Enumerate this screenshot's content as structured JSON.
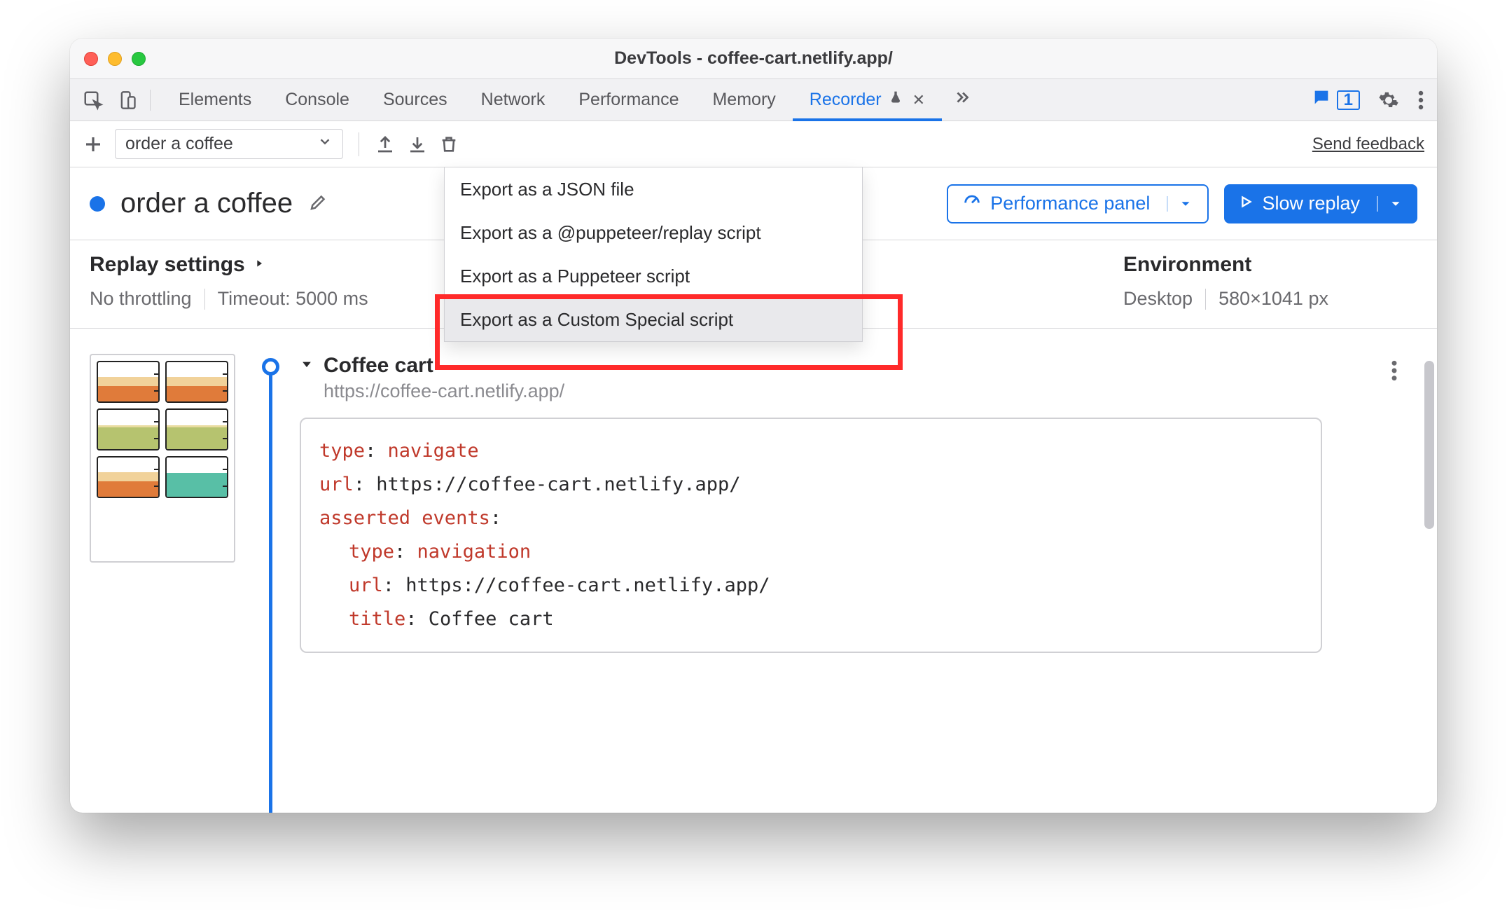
{
  "window": {
    "title": "DevTools - coffee-cart.netlify.app/"
  },
  "tabs": {
    "items": [
      "Elements",
      "Console",
      "Sources",
      "Network",
      "Performance",
      "Memory",
      "Recorder"
    ],
    "active": "Recorder",
    "issues_count": "1"
  },
  "subbar": {
    "recording_select": "order a coffee",
    "send_feedback": "Send feedback"
  },
  "header": {
    "name": "order a coffee",
    "perf_panel": "Performance panel",
    "slow_replay": "Slow replay"
  },
  "export_menu": {
    "items": [
      "Export as a JSON file",
      "Export as a @puppeteer/replay script",
      "Export as a Puppeteer script",
      "Export as a Custom Special script"
    ],
    "hovered_index": 3
  },
  "replay": {
    "heading": "Replay settings",
    "throttling": "No throttling",
    "timeout": "Timeout: 5000 ms"
  },
  "env": {
    "heading": "Environment",
    "device": "Desktop",
    "viewport": "580×1041 px"
  },
  "step": {
    "title": "Coffee cart",
    "url": "https://coffee-cart.netlify.app/",
    "code": {
      "l1k": "type",
      "l1v": "navigate",
      "l2k": "url",
      "l2v": "https://coffee-cart.netlify.app/",
      "l3k": "asserted events",
      "l4k": "type",
      "l4v": "navigation",
      "l5k": "url",
      "l5v": "https://coffee-cart.netlify.app/",
      "l6k": "title",
      "l6v": "Coffee cart"
    }
  }
}
